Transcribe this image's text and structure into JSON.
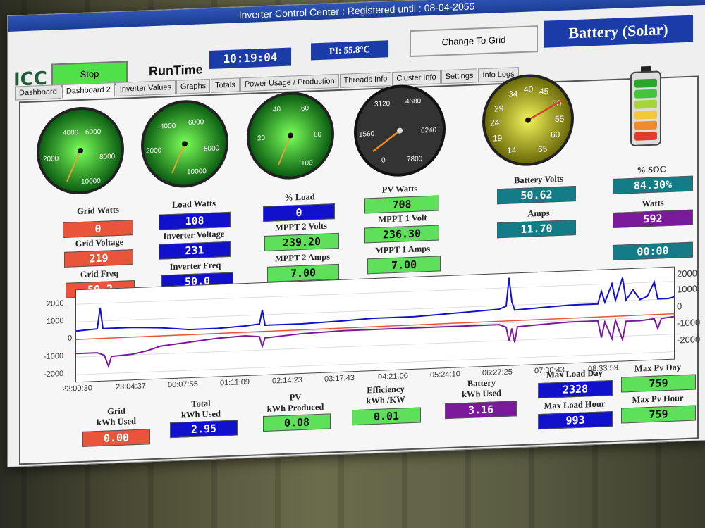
{
  "window": {
    "title": "Inverter Control Center : Registered until : 08-04-2055"
  },
  "header": {
    "logo": "ICC",
    "stop_label": "Stop",
    "runtime_label": "RunTime",
    "runtime_value": "10:19:04",
    "pi_temp": "PI: 55.8°C",
    "change_grid_label": "Change To Grid",
    "mode_label": "Battery (Solar)"
  },
  "tabs": [
    "Dashboard",
    "Dashboard 2",
    "Inverter Values",
    "Graphs",
    "Totals",
    "Power Usage / Production",
    "Threads Info",
    "Cluster Info",
    "Settings",
    "Info Logs"
  ],
  "gauges": [
    {
      "ticks": [
        "4000",
        "6000",
        "2000",
        "8000",
        "10000"
      ]
    },
    {
      "ticks": [
        "4000",
        "6000",
        "2000",
        "8000",
        "10000"
      ]
    },
    {
      "ticks": [
        "40",
        "60",
        "20",
        "80",
        "100"
      ]
    },
    {
      "ticks": [
        "3120",
        "4680",
        "1560",
        "6240",
        "0",
        "7800"
      ]
    },
    {
      "ticks": [
        "34",
        "40",
        "45",
        "29",
        "50",
        "24",
        "55",
        "19",
        "60",
        "14",
        "65"
      ]
    }
  ],
  "readings": {
    "grid_watts": {
      "label": "Grid Watts",
      "value": "0"
    },
    "grid_voltage": {
      "label": "Grid Voltage",
      "value": "219"
    },
    "grid_freq": {
      "label": "Grid Freq",
      "value": "50.2"
    },
    "load_watts": {
      "label": "Load Watts",
      "value": "108"
    },
    "inverter_voltage": {
      "label": "Inverter Voltage",
      "value": "231"
    },
    "inverter_freq": {
      "label": "Inverter Freq",
      "value": "50.0"
    },
    "pct_load": {
      "label": "% Load",
      "value": "0"
    },
    "mppt2_volts": {
      "label": "MPPT 2 Volts",
      "value": "239.20"
    },
    "mppt2_amps": {
      "label": "MPPT 2 Amps",
      "value": "7.00"
    },
    "pv_watts": {
      "label": "PV Watts",
      "value": "708"
    },
    "mppt1_volt": {
      "label": "MPPT 1 Volt",
      "value": "236.30"
    },
    "mppt1_amps": {
      "label": "MPPT 1 Amps",
      "value": "7.00"
    },
    "battery_volts": {
      "label": "Battery Volts",
      "value": "50.62"
    },
    "amps": {
      "label": "Amps",
      "value": "11.70"
    },
    "soc": {
      "label": "% SOC",
      "value": "84.30%"
    },
    "watts": {
      "label": "Watts",
      "value": "592"
    },
    "time": {
      "value": "00:00"
    }
  },
  "chart": {
    "y_left": [
      "2000",
      "1000",
      "0",
      "-1000",
      "-2000"
    ],
    "y_right": [
      "2000",
      "1000",
      "0",
      "-1000",
      "-2000"
    ],
    "x": [
      "22:00:30",
      "23:04:37",
      "00:07:55",
      "01:11:09",
      "02:14:23",
      "03:17:43",
      "04:21:00",
      "05:24:10",
      "06:27:25",
      "07:30:43",
      "08:33:59"
    ]
  },
  "totals": {
    "grid": {
      "label1": "Grid",
      "label2": "kWh Used",
      "value": "0.00"
    },
    "total": {
      "label1": "Total",
      "label2": "kWh Used",
      "value": "2.95"
    },
    "pv": {
      "label1": "PV",
      "label2": "kWh Produced",
      "value": "0.08"
    },
    "eff": {
      "label1": "Efficiency",
      "label2": "kWh /KW",
      "value": "0.01"
    },
    "batt": {
      "label1": "Battery",
      "label2": "kWh Used",
      "value": "3.16"
    },
    "max_load_day": {
      "label": "Max Load Day",
      "value": "2328"
    },
    "max_load_hour": {
      "label": "Max Load Hour",
      "value": "993"
    },
    "max_pv_day": {
      "label": "Max Pv Day",
      "value": "759"
    },
    "max_pv_hour": {
      "label": "Max Pv Hour",
      "value": "759"
    }
  }
}
